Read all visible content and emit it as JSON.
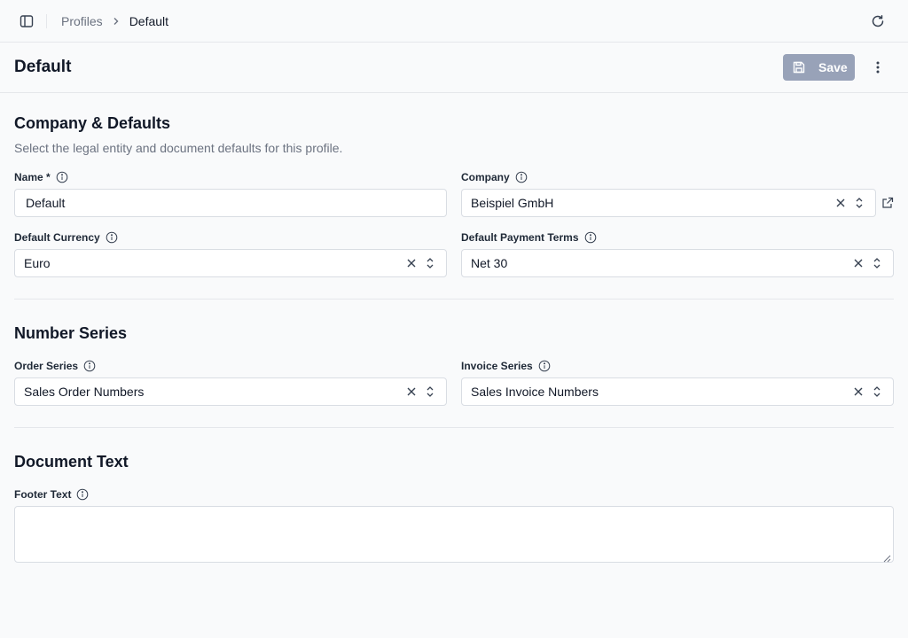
{
  "breadcrumb": {
    "parent": "Profiles",
    "current": "Default"
  },
  "header": {
    "title": "Default",
    "save_label": "Save"
  },
  "sections": {
    "company": {
      "title": "Company & Defaults",
      "description": "Select the legal entity and document defaults for this profile.",
      "name": {
        "label": "Name *",
        "value": "Default"
      },
      "company": {
        "label": "Company",
        "value": "Beispiel GmbH"
      },
      "currency": {
        "label": "Default Currency",
        "value": "Euro"
      },
      "payment_terms": {
        "label": "Default Payment Terms",
        "value": "Net 30"
      }
    },
    "number_series": {
      "title": "Number Series",
      "order_series": {
        "label": "Order Series",
        "value": "Sales Order Numbers"
      },
      "invoice_series": {
        "label": "Invoice Series",
        "value": "Sales Invoice Numbers"
      }
    },
    "document_text": {
      "title": "Document Text",
      "footer": {
        "label": "Footer Text",
        "value": ""
      }
    }
  },
  "colors": {
    "primary_disabled": "#98a2b8",
    "border": "#d9dde3",
    "muted_text": "#6b7280"
  }
}
